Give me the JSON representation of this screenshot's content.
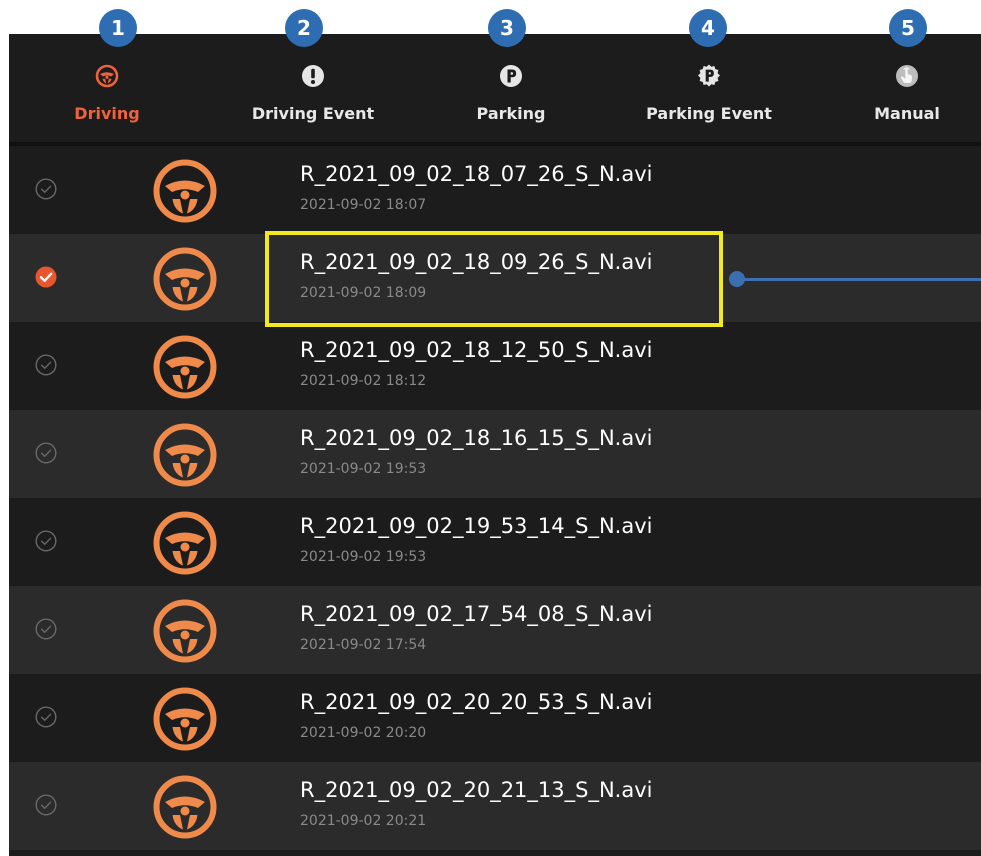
{
  "tabs": [
    {
      "label": "Driving",
      "icon": "steering-wheel-icon",
      "badge": "1",
      "active": true
    },
    {
      "label": "Driving Event",
      "icon": "exclamation-icon",
      "badge": "2",
      "active": false
    },
    {
      "label": "Parking",
      "icon": "parking-icon",
      "badge": "3",
      "active": false
    },
    {
      "label": "Parking Event",
      "icon": "parking-event-icon",
      "badge": "4",
      "active": false
    },
    {
      "label": "Manual",
      "icon": "hand-touch-icon",
      "badge": "5",
      "active": false
    }
  ],
  "files": [
    {
      "name": "R_2021_09_02_18_07_26_S_N.avi",
      "date": "2021-09-02 18:07",
      "checked": false
    },
    {
      "name": "R_2021_09_02_18_09_26_S_N.avi",
      "date": "2021-09-02 18:09",
      "checked": true
    },
    {
      "name": "R_2021_09_02_18_12_50_S_N.avi",
      "date": "2021-09-02 18:12",
      "checked": false
    },
    {
      "name": "R_2021_09_02_18_16_15_S_N.avi",
      "date": "2021-09-02 19:53",
      "checked": false
    },
    {
      "name": "R_2021_09_02_19_53_14_S_N.avi",
      "date": "2021-09-02 19:53",
      "checked": false
    },
    {
      "name": "R_2021_09_02_17_54_08_S_N.avi",
      "date": "2021-09-02 17:54",
      "checked": false
    },
    {
      "name": "R_2021_09_02_20_20_53_S_N.avi",
      "date": "2021-09-02 20:20",
      "checked": false
    },
    {
      "name": "R_2021_09_02_20_21_13_S_N.avi",
      "date": "2021-09-02 20:21",
      "checked": false
    }
  ],
  "colors": {
    "accent": "#e8562f",
    "badge": "#2f6db3",
    "highlight": "#f2ea1e",
    "pointer": "#3c6fb0"
  }
}
